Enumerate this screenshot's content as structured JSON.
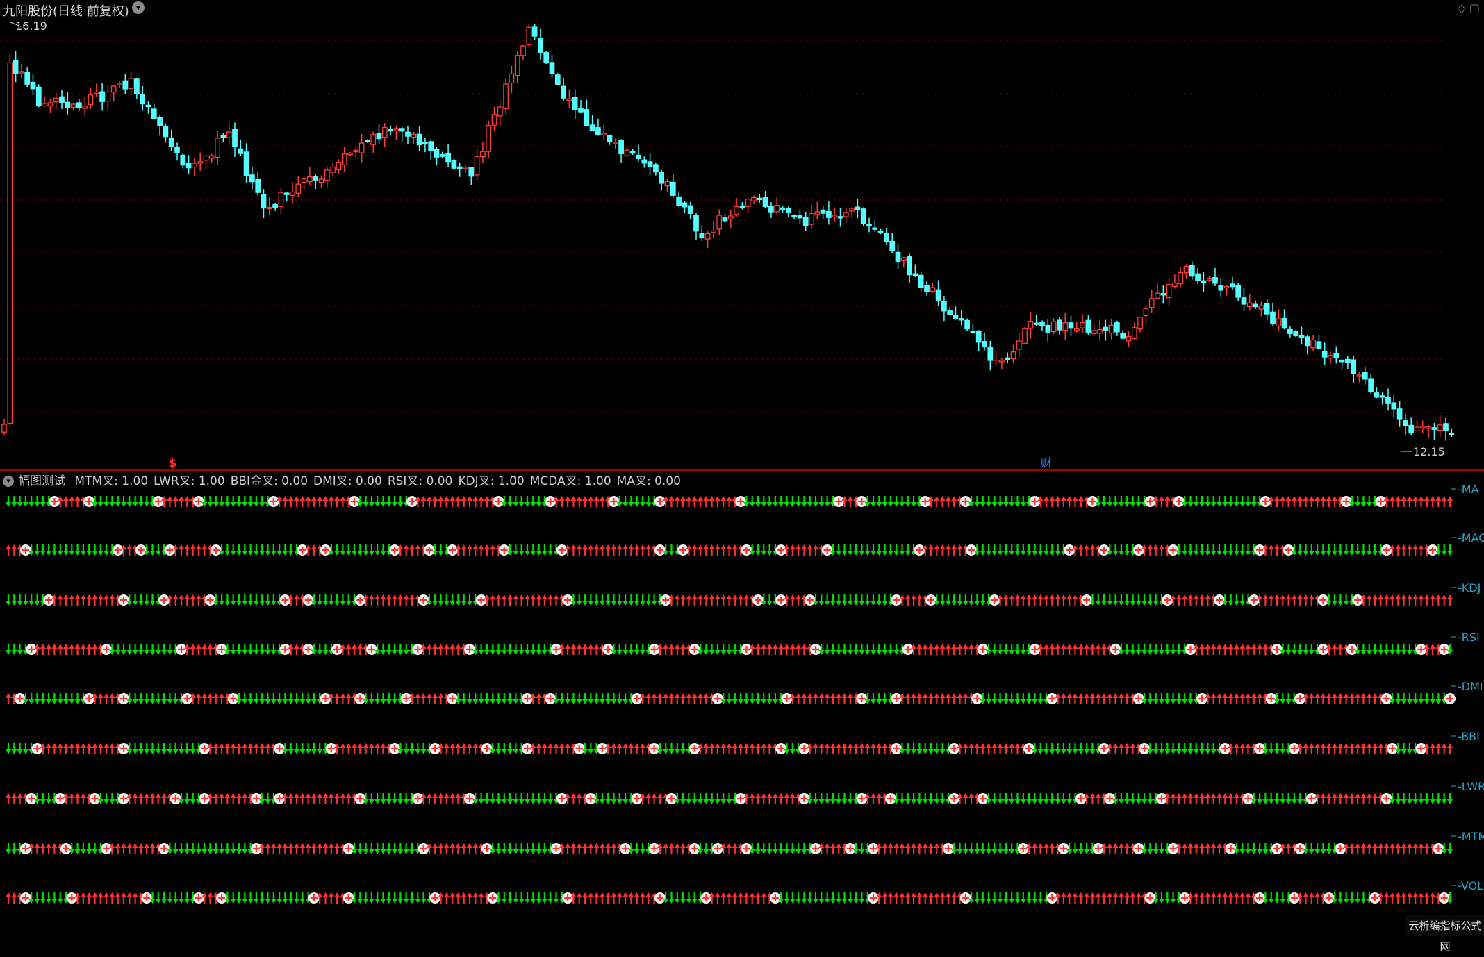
{
  "title": "九阳股份(日线 前复权)",
  "window_icons": [
    "◇",
    "▢"
  ],
  "price_high_label": "16.19",
  "price_low_label": "12.15",
  "markers": {
    "s_marker": "$",
    "cai_marker": "财"
  },
  "indicator_bar": {
    "name": "幅图测试",
    "items": [
      {
        "label": "MTM叉",
        "value": "1.00"
      },
      {
        "label": "LWR叉",
        "value": "1.00"
      },
      {
        "label": "BBI金叉",
        "value": "0.00"
      },
      {
        "label": "DMI叉",
        "value": "0.00"
      },
      {
        "label": "RSI叉",
        "value": "0.00"
      },
      {
        "label": "KDJ叉",
        "value": "1.00"
      },
      {
        "label": "MCDA叉",
        "value": "1.00"
      },
      {
        "label": "MA叉",
        "value": "0.00"
      }
    ]
  },
  "signal_rows": [
    {
      "label": "MA"
    },
    {
      "label": "MAC"
    },
    {
      "label": "KDJ"
    },
    {
      "label": "RSI"
    },
    {
      "label": "DMI"
    },
    {
      "label": "BBI"
    },
    {
      "label": "LWR"
    },
    {
      "label": "MTM"
    },
    {
      "label": "VOL"
    }
  ],
  "colors": {
    "up": "#ff3030",
    "down": "#00e000",
    "candle_up": "#ff3c3c",
    "candle_down": "#54ffff",
    "grid": "#7a0000",
    "axis_label": "#2aa6c8"
  },
  "watermark": "云析编指标公式网"
}
